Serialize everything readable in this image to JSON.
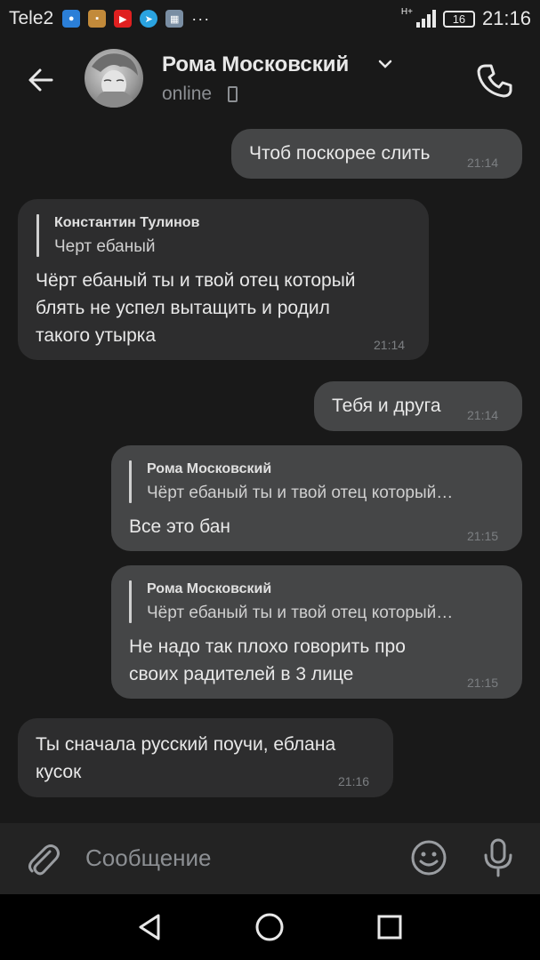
{
  "statusbar": {
    "carrier": "Tele2",
    "network": "H+",
    "battery": "16",
    "time": "21:16",
    "more": "···",
    "notifications": [
      {
        "icon": "messages-icon",
        "color": "#2b7fd8"
      },
      {
        "icon": "wallet-icon",
        "color": "#c28a3a"
      },
      {
        "icon": "youtube-icon",
        "color": "#e02020"
      },
      {
        "icon": "telegram-icon",
        "color": "#2aa3e0"
      },
      {
        "icon": "gallery-icon",
        "color": "#7a8ea3"
      }
    ]
  },
  "header": {
    "name": "Рома Московский",
    "status": "online"
  },
  "messages": [
    {
      "direction": "out",
      "text": "Чтоб поскорее слить",
      "time": "21:14"
    },
    {
      "direction": "in",
      "reply_author": "Константин Тулинов",
      "reply_text": "Черт ебаный",
      "text_lines": [
        "Чёрт ебаный ты и твой отец который",
        "блять не успел вытащить и родил",
        "такого утырка"
      ],
      "time": "21:14"
    },
    {
      "direction": "out",
      "text": "Тебя и друга",
      "time": "21:14"
    },
    {
      "direction": "out",
      "reply_author": "Рома Московский",
      "reply_text": "Чёрт ебаный ты и твой отец который…",
      "text": "Все это бан",
      "time": "21:15"
    },
    {
      "direction": "out",
      "reply_author": "Рома Московский",
      "reply_text": "Чёрт ебаный ты и твой отец который…",
      "text_lines": [
        "Не надо так плохо говорить про",
        "своих радителей в 3 лице"
      ],
      "time": "21:15"
    },
    {
      "direction": "in",
      "text_lines": [
        "Ты сначала русский поучи, еблана",
        "кусок"
      ],
      "time": "21:16"
    }
  ],
  "composer": {
    "placeholder": "Сообщение"
  },
  "colors": {
    "background": "#191919",
    "outgoing_bubble": "#454647",
    "incoming_bubble": "#2d2d2e"
  }
}
